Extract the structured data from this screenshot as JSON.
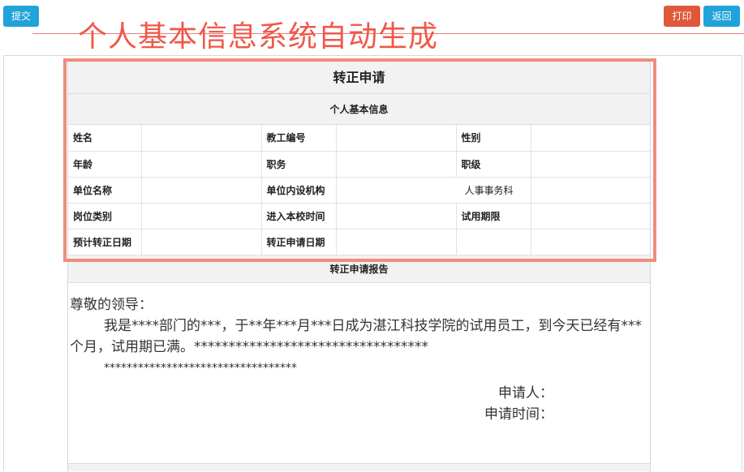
{
  "toolbar": {
    "submit_label": "提交",
    "print_label": "打印",
    "back_label": "返回"
  },
  "overlay_caption": "个人基本信息系统自动生成",
  "form": {
    "title": "转正申请",
    "section_basic_info": "个人基本信息",
    "rows": [
      [
        {
          "label": "姓名",
          "value": ""
        },
        {
          "label": "教工编号",
          "value": ""
        },
        {
          "label": "性别",
          "value": ""
        }
      ],
      [
        {
          "label": "年龄",
          "value": ""
        },
        {
          "label": "职务",
          "value": ""
        },
        {
          "label": "职级",
          "value": ""
        }
      ],
      [
        {
          "label": "单位名称",
          "value": ""
        },
        {
          "label": "单位内设机构",
          "value": "人事事务科"
        },
        {
          "label": "",
          "value": ""
        }
      ],
      [
        {
          "label": "岗位类别",
          "value": ""
        },
        {
          "label": "进入本校时间",
          "value": ""
        },
        {
          "label": "试用期限",
          "value": ""
        }
      ],
      [
        {
          "label": "预计转正日期",
          "value": ""
        },
        {
          "label": "转正申请日期",
          "value": ""
        },
        {
          "label": "",
          "value": ""
        }
      ]
    ],
    "section_report": "转正申请报告",
    "letter": {
      "greeting": "尊敬的领导：",
      "body": "我是****部门的***，于**年***月***日成为湛江科技学院的试用员工，到今天已经有***个月，试用期已满。**********************************",
      "stars_line": "**********************************",
      "applicant_label": "申请人：",
      "apply_time_label": "申请时间："
    }
  },
  "colors": {
    "primary_button": "#1fa3d8",
    "danger_button": "#e0583a",
    "annotation_red": "#f0584a",
    "highlight_box": "#f08c7e"
  }
}
